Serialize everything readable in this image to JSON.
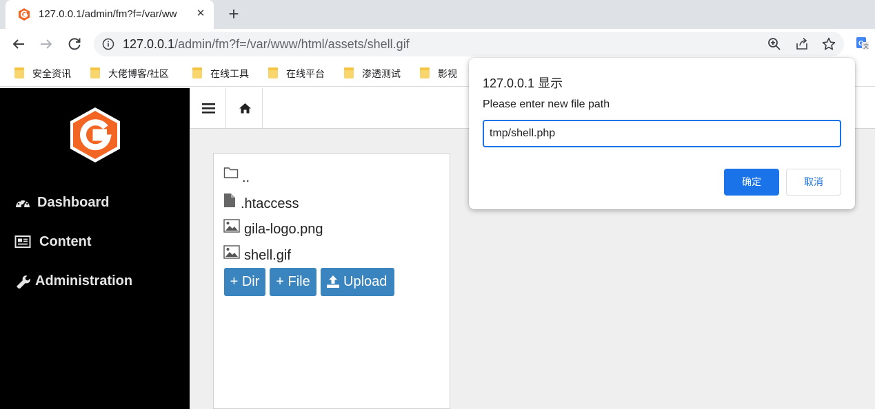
{
  "browser": {
    "tab_title": "127.0.0.1/admin/fm?f=/var/ww",
    "url_host": "127.0.0.1",
    "url_path": "/admin/fm?f=/var/www/html/assets/shell.gif",
    "bookmarks": [
      {
        "label": "安全资讯"
      },
      {
        "label": "大佬博客/社区"
      },
      {
        "label": "在线工具"
      },
      {
        "label": "在线平台"
      },
      {
        "label": "渗透测试"
      },
      {
        "label": "影视"
      }
    ]
  },
  "sidebar": {
    "items": [
      {
        "label": "Dashboard"
      },
      {
        "label": "Content"
      },
      {
        "label": "Administration"
      }
    ]
  },
  "files": {
    "items": [
      {
        "name": "..",
        "icon": "folder-icon"
      },
      {
        "name": ".htaccess",
        "icon": "file-icon"
      },
      {
        "name": "gila-logo.png",
        "icon": "image-icon"
      },
      {
        "name": "shell.gif",
        "icon": "image-icon"
      }
    ],
    "buttons": {
      "dir": "+ Dir",
      "file": "+ File",
      "upload": "Upload"
    }
  },
  "dialog": {
    "title": "127.0.0.1 显示",
    "message": "Please enter new file path",
    "input_value": "tmp/shell.php",
    "ok": "确定",
    "cancel": "取消"
  },
  "colors": {
    "accent": "#1a73e8",
    "brand_orange": "#f26522",
    "button_blue": "#3a85bf"
  }
}
